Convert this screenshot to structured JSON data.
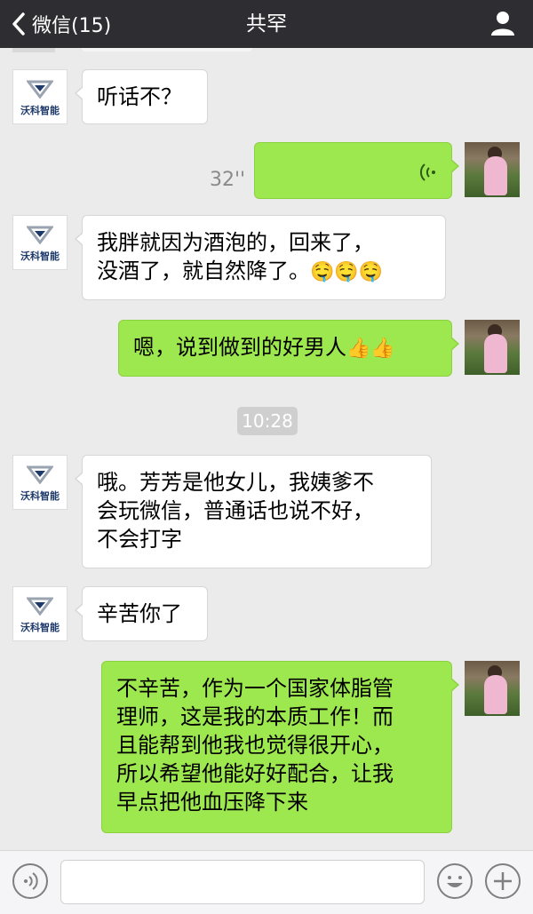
{
  "header": {
    "back_label": "微信(15)",
    "title": "共罕"
  },
  "contact": {
    "logo_text": "沃科智能"
  },
  "messages": [
    {
      "side": "in",
      "text": "听话不？"
    },
    {
      "side": "out",
      "type": "voice",
      "duration": "32''"
    },
    {
      "side": "in",
      "line1": "我胖就因为酒泡的，回来了，",
      "line2": "没酒了，就自然降了。",
      "emoji": "🤤🤤🤤"
    },
    {
      "side": "out",
      "text": "嗯，说到做到的好男人",
      "emoji": "👍👍"
    },
    {
      "type": "time",
      "text": "10:28"
    },
    {
      "side": "in",
      "line1": "哦。芳芳是他女儿，我姨爹不",
      "line2": "会玩微信，普通话也说不好，",
      "line3": "不会打字"
    },
    {
      "side": "in",
      "text": "辛苦你了"
    },
    {
      "side": "out",
      "line1": "不辛苦，作为一个国家体脂管",
      "line2": "理师，这是我的本质工作！而",
      "line3": "且能帮到他我也觉得很开心，",
      "line4": "所以希望他能好好配合，让我",
      "line5": "早点把他血压降下来"
    }
  ],
  "input_bar": {
    "voice_icon": "voice-mode-icon",
    "emoji_icon": "emoji-icon",
    "plus_icon": "plus-icon",
    "placeholder": ""
  },
  "colors": {
    "header_bg": "#2e2e32",
    "chat_bg": "#ebebeb",
    "out_bubble": "#9ee84f",
    "in_bubble": "#ffffff"
  }
}
